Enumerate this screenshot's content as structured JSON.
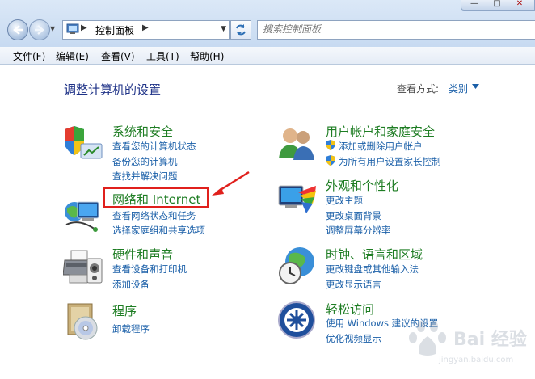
{
  "window": {
    "minimize_symbol": "—",
    "maximize_symbol": "□",
    "close_symbol": "✕"
  },
  "toolbar": {
    "back_icon": "back-arrow-icon",
    "forward_icon": "forward-arrow-icon",
    "address_path": "控制面板",
    "address_chevron_1": "▶",
    "address_chevron_2": "▶",
    "dropdown_symbol": "▼",
    "refresh_icon": "refresh-icon",
    "search_placeholder": "搜索控制面板"
  },
  "menu": [
    {
      "label": "文件(F)"
    },
    {
      "label": "编辑(E)"
    },
    {
      "label": "查看(V)"
    },
    {
      "label": "工具(T)"
    },
    {
      "label": "帮助(H)"
    }
  ],
  "main": {
    "heading": "调整计算机的设置",
    "view_by_label": "查看方式:",
    "view_by_value": "类别"
  },
  "categories_left": [
    {
      "title": "系统和安全",
      "icon": "shield-icon",
      "links": [
        "查看您的计算机状态",
        "备份您的计算机",
        "查找并解决问题"
      ]
    },
    {
      "title": "网络和 Internet",
      "icon": "network-icon",
      "links": [
        "查看网络状态和任务",
        "选择家庭组和共享选项"
      ]
    },
    {
      "title": "硬件和声音",
      "icon": "printer-icon",
      "links": [
        "查看设备和打印机",
        "添加设备"
      ]
    },
    {
      "title": "程序",
      "icon": "programs-icon",
      "links": [
        "卸载程序"
      ]
    }
  ],
  "categories_right": [
    {
      "title": "用户帐户和家庭安全",
      "icon": "users-icon",
      "links": [
        "添加或删除用户帐户",
        "为所有用户设置家长控制"
      ]
    },
    {
      "title": "外观和个性化",
      "icon": "appearance-icon",
      "links": [
        "更改主题",
        "更改桌面背景",
        "调整屏幕分辨率"
      ]
    },
    {
      "title": "时钟、语言和区域",
      "icon": "clock-globe-icon",
      "links": [
        "更改键盘或其他输入法",
        "更改显示语言"
      ]
    },
    {
      "title": "轻松访问",
      "icon": "ease-of-access-icon",
      "links": [
        "使用 Windows 建议的设置",
        "优化视频显示"
      ]
    }
  ],
  "watermark": {
    "text": "Bai 经验",
    "sub": "jingyan.baidu.com"
  },
  "colors": {
    "title_green": "#1e7d23",
    "link_blue": "#1a5fa8",
    "heading_blue": "#1e3287",
    "annotation_red": "#e0201c"
  }
}
